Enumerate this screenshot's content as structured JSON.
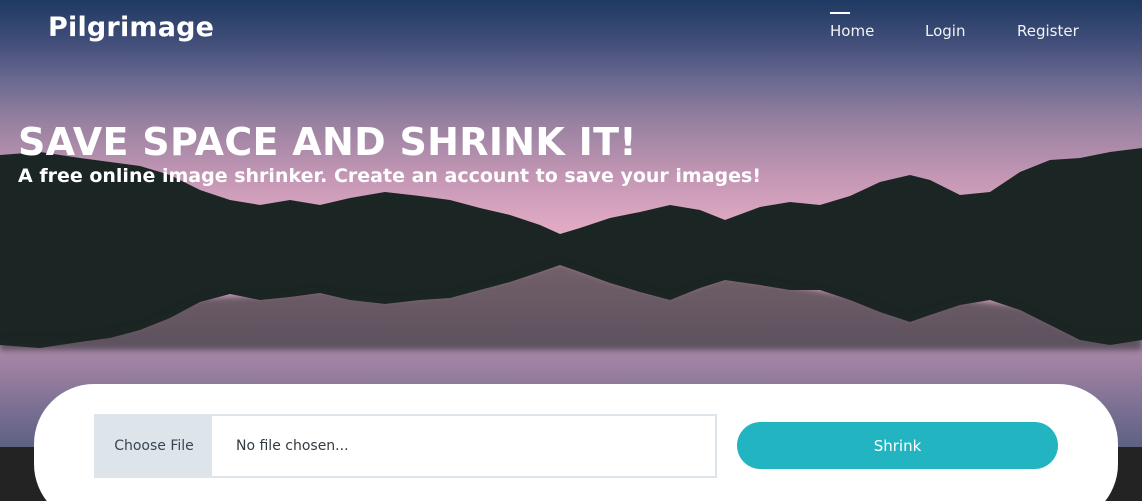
{
  "brand": {
    "name": "Pilgrimage"
  },
  "nav": {
    "items": [
      {
        "label": "Home",
        "active": true
      },
      {
        "label": "Login",
        "active": false
      },
      {
        "label": "Register",
        "active": false
      }
    ]
  },
  "hero": {
    "title": "SAVE SPACE AND SHRINK IT!",
    "subtitle": "A free online image shrinker. Create an account to save your images!"
  },
  "upload": {
    "choose_label": "Choose File",
    "file_status": "No file chosen...",
    "submit_label": "Shrink"
  },
  "colors": {
    "accent": "#22b4c1",
    "mountain": "#1b2524",
    "sky_top": "#1f3a62",
    "sky_horizon": "#e3abc5",
    "footer": "#232323"
  }
}
